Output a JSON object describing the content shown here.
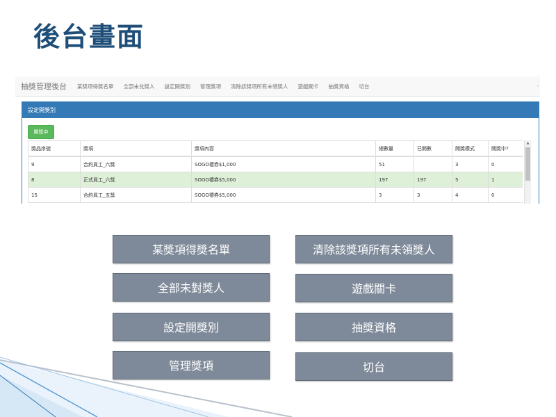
{
  "slide": {
    "title": "後台畫面"
  },
  "app": {
    "brand": "抽獎管理後台",
    "nav_items": [
      "某獎項得獎名單",
      "全部未兌獎人",
      "設定開獎別",
      "管理獎項",
      "清除該獎項所有未領獎人",
      "遊戲關卡",
      "抽獎資格",
      "切台"
    ],
    "nav_end": "-",
    "panel_title": "設定開獎別",
    "status_button": "開獎中",
    "table": {
      "headers": [
        "獎品序號",
        "獎項",
        "獎項內容",
        "總數量",
        "已開數",
        "開獎模式",
        "開獎中?"
      ],
      "rows": [
        [
          "9",
          "合約員工_六獎",
          "SOGO禮券$1,000",
          "51",
          "",
          "3",
          "0"
        ],
        [
          "8",
          "正式員工_六獎",
          "SOGO禮券$5,000",
          "197",
          "197",
          "5",
          "1"
        ],
        [
          "15",
          "合約員工_五獎",
          "SOGO禮券$5,000",
          "3",
          "3",
          "4",
          "0"
        ]
      ],
      "highlighted_row_index": 1
    },
    "colors": {
      "navbar_bg": "#f8f8f8",
      "panel_primary": "#337ab7",
      "success_green": "#5cb85c",
      "row_highlight": "#dff0d8"
    }
  },
  "menu_buttons": {
    "winner_list": "某獎項得獎名單",
    "clear_unclaimed": "清除該獎項所有未領獎人",
    "all_unredeemed": "全部未對獎人",
    "game_levels": "遊戲關卡",
    "set_draw": "設定開獎別",
    "draw_eligibility": "抽獎資格",
    "manage_prizes": "管理獎項",
    "switch_stage": "切台",
    "color": "#7e8a99"
  }
}
